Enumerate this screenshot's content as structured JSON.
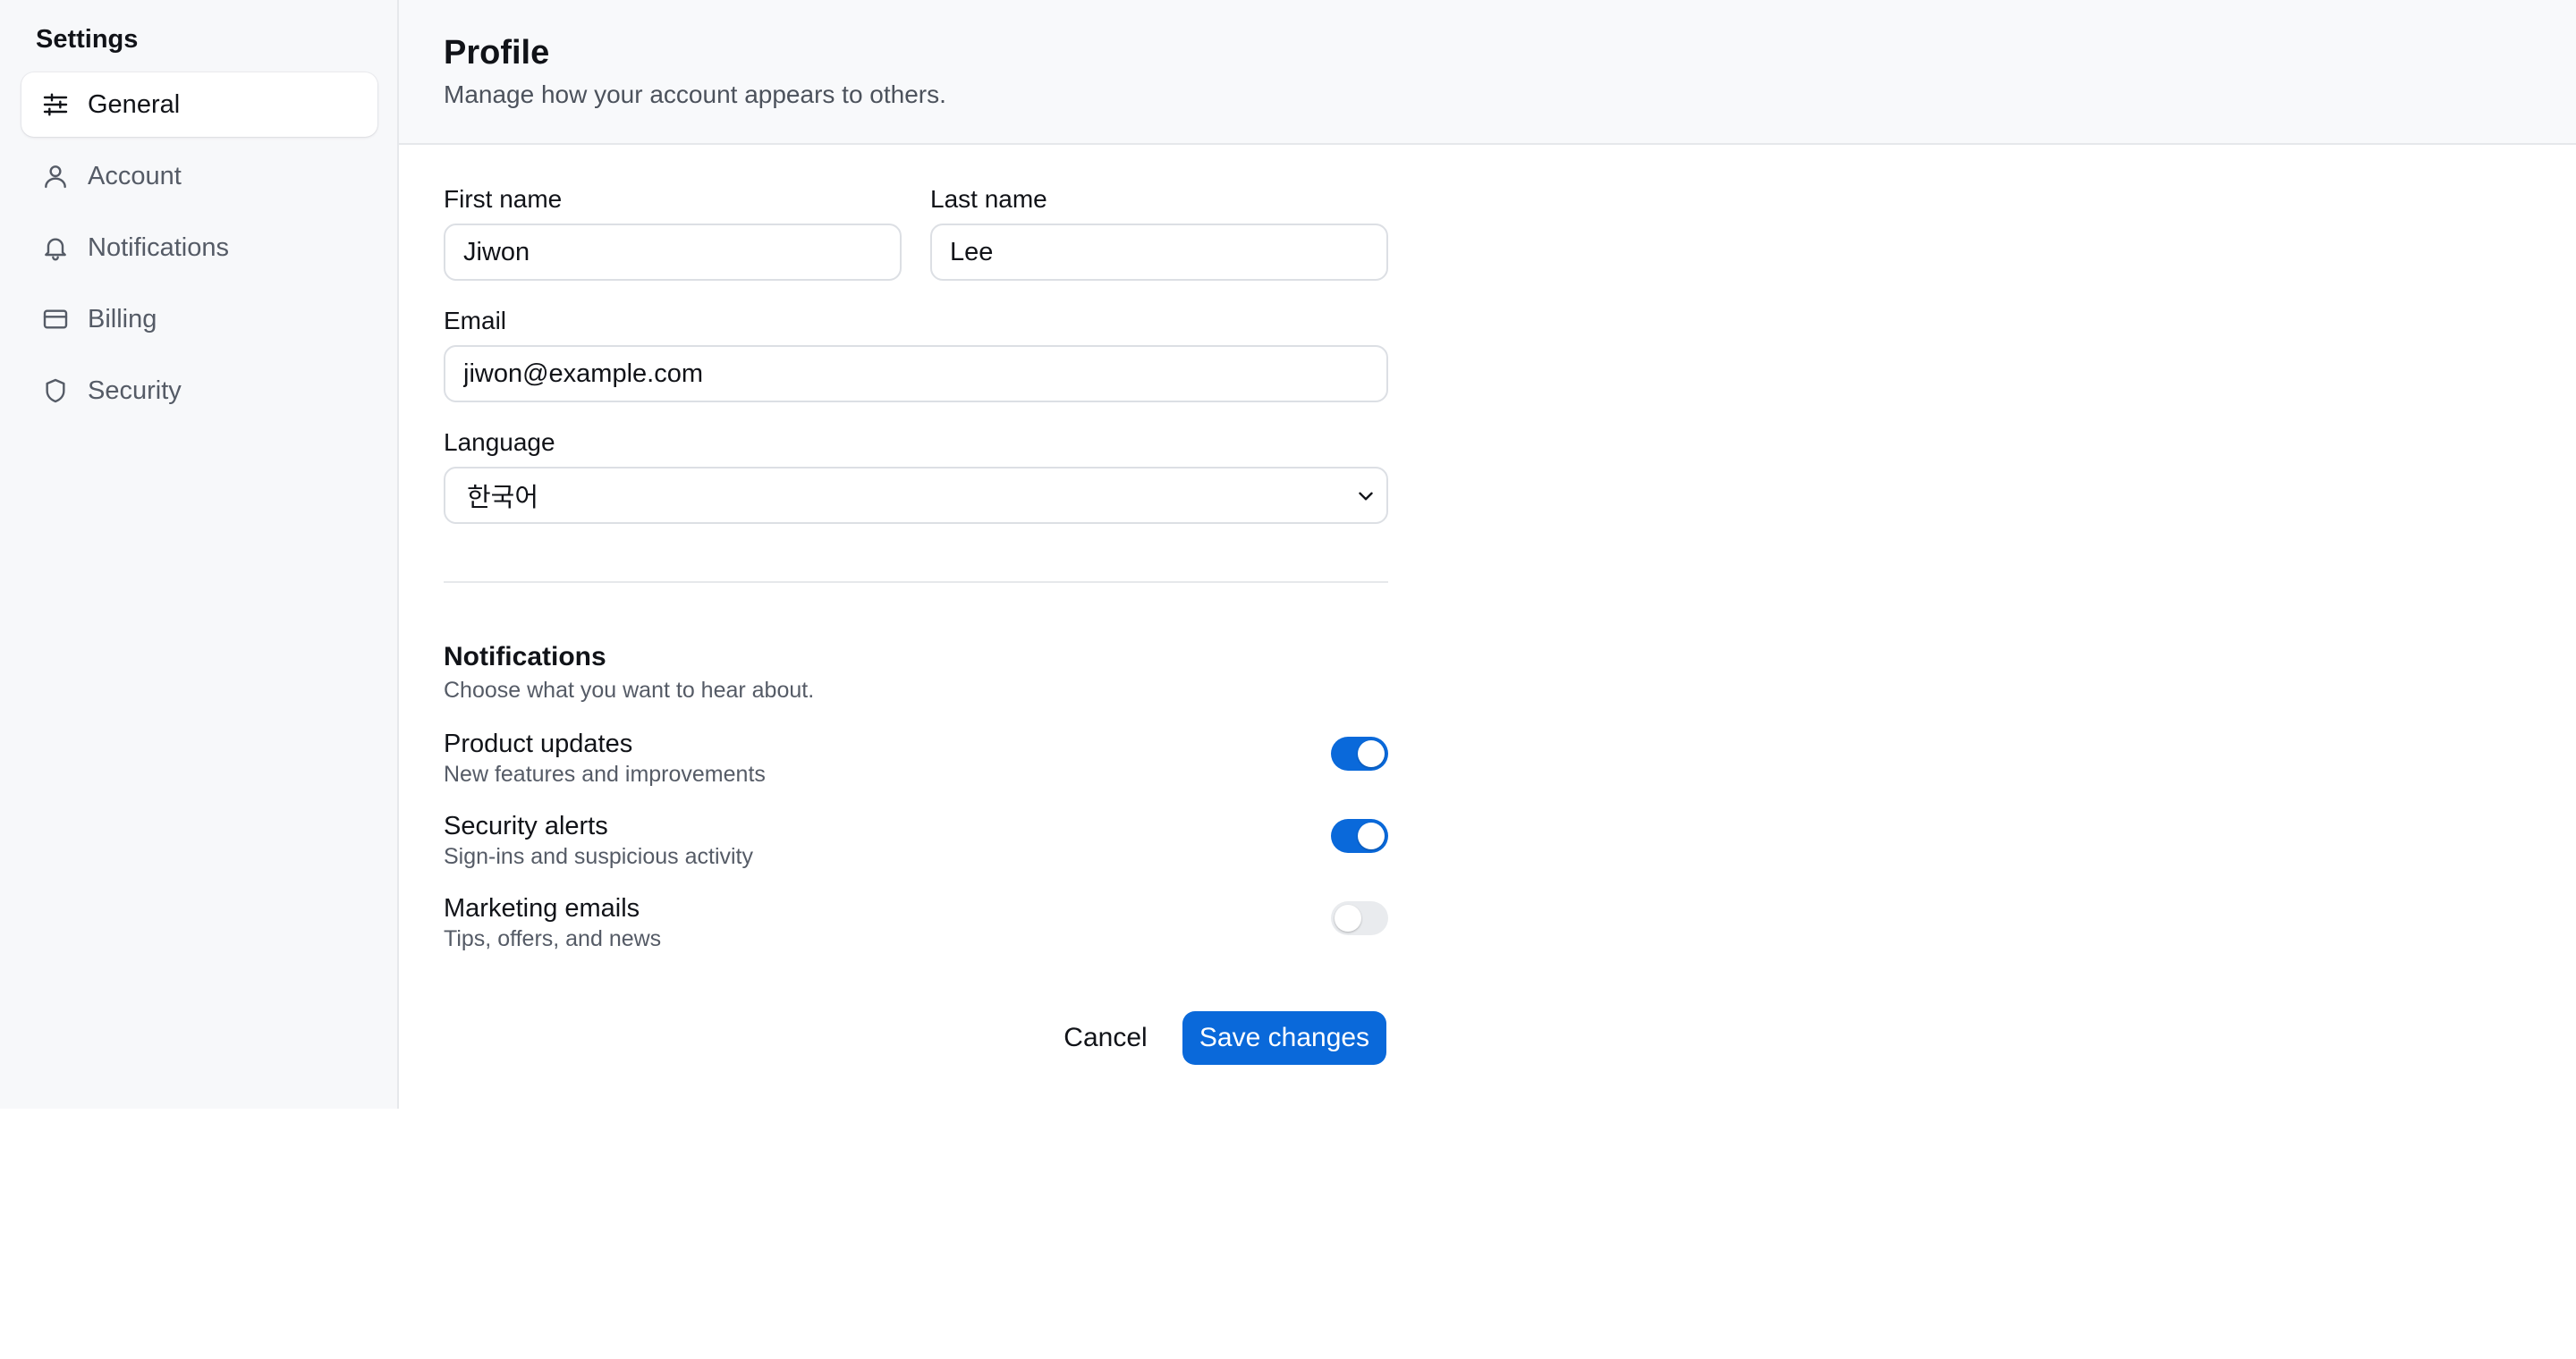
{
  "sidebar": {
    "title": "Settings",
    "items": [
      {
        "label": "General",
        "icon": "sliders-icon",
        "active": true
      },
      {
        "label": "Account",
        "icon": "user-icon",
        "active": false
      },
      {
        "label": "Notifications",
        "icon": "bell-icon",
        "active": false
      },
      {
        "label": "Billing",
        "icon": "credit-card-icon",
        "active": false
      },
      {
        "label": "Security",
        "icon": "shield-icon",
        "active": false
      }
    ]
  },
  "header": {
    "title": "Profile",
    "subtitle": "Manage how your account appears to others."
  },
  "form": {
    "first_name": {
      "label": "First name",
      "value": "Jiwon"
    },
    "last_name": {
      "label": "Last name",
      "value": "Lee"
    },
    "email": {
      "label": "Email",
      "value": "jiwon@example.com"
    },
    "language": {
      "label": "Language",
      "value": "한국어"
    }
  },
  "notifications": {
    "title": "Notifications",
    "subtitle": "Choose what you want to hear about.",
    "items": [
      {
        "title": "Product updates",
        "desc": "New features and improvements",
        "enabled": true
      },
      {
        "title": "Security alerts",
        "desc": "Sign-ins and suspicious activity",
        "enabled": true
      },
      {
        "title": "Marketing emails",
        "desc": "Tips, offers, and news",
        "enabled": false
      }
    ]
  },
  "actions": {
    "cancel_label": "Cancel",
    "save_label": "Save changes"
  },
  "colors": {
    "accent": "#0a69da",
    "sidebar_bg": "#f7f8fa",
    "toggle_off": "#e9ebee"
  }
}
